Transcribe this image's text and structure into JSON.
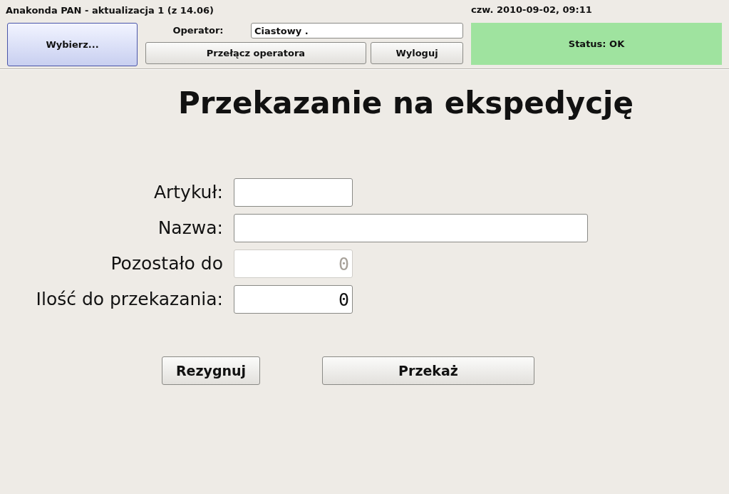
{
  "window": {
    "title": "Anakonda PAN - aktualizacja 1 (z 14.06)",
    "datetime": "czw. 2010-09-02, 09:11"
  },
  "header": {
    "select_button": "Wybierz...",
    "operator_label": "Operator:",
    "operator_value": "Ciastowy .",
    "switch_button": "Przełącz operatora",
    "logout_button": "Wyloguj",
    "status": "Status: OK"
  },
  "page_title": "Przekazanie na ekspedycję",
  "fields": [
    {
      "label": "Artykuł:",
      "kind": "short",
      "disabled": false
    },
    {
      "label": "Nazwa:",
      "kind": "wide",
      "disabled": false
    },
    {
      "label": "Pozostało do",
      "value": "0",
      "kind": "short",
      "disabled": true
    },
    {
      "label": "Ilość do przekazania:",
      "value": "0",
      "kind": "short",
      "disabled": false
    }
  ],
  "buttons": [
    "Rezygnuj",
    "Przekaż"
  ]
}
